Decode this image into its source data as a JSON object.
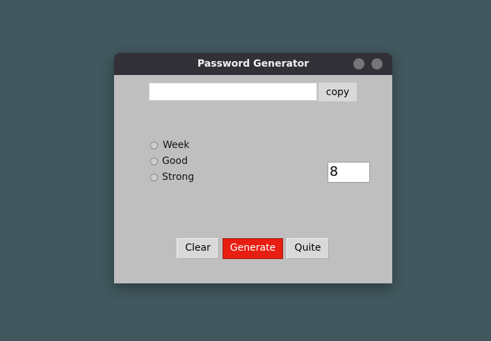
{
  "window": {
    "title": "Password Generator",
    "controls": [
      "minimize-icon",
      "close-icon"
    ]
  },
  "password_field": {
    "value": "",
    "placeholder": ""
  },
  "copy_button": {
    "label": "copy"
  },
  "strength": {
    "options": [
      {
        "label": "Week",
        "selected": false
      },
      {
        "label": "Good",
        "selected": false
      },
      {
        "label": "Strong",
        "selected": false
      }
    ]
  },
  "length": {
    "value": "8"
  },
  "actions": {
    "clear_label": "Clear",
    "generate_label": "Generate",
    "quite_label": "Quite"
  },
  "colors": {
    "desktop": "#41585e",
    "titlebar": "#313137",
    "panel": "#bfbfbf",
    "generate_accent": "#e81e12"
  }
}
